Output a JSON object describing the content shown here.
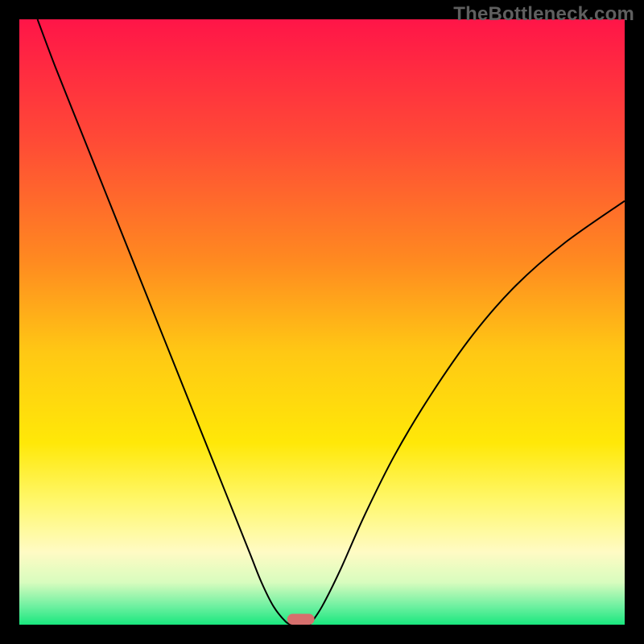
{
  "watermark": "TheBottleneck.com",
  "chart_data": {
    "type": "line",
    "title": "",
    "xlabel": "",
    "ylabel": "",
    "xlim": [
      0,
      100
    ],
    "ylim": [
      0,
      100
    ],
    "background_gradient": {
      "stops": [
        {
          "offset": 0.0,
          "color": "#ff1548"
        },
        {
          "offset": 0.2,
          "color": "#ff4a36"
        },
        {
          "offset": 0.4,
          "color": "#ff8a20"
        },
        {
          "offset": 0.55,
          "color": "#ffc814"
        },
        {
          "offset": 0.7,
          "color": "#ffe808"
        },
        {
          "offset": 0.8,
          "color": "#fff870"
        },
        {
          "offset": 0.88,
          "color": "#fffbc4"
        },
        {
          "offset": 0.93,
          "color": "#d8fcbe"
        },
        {
          "offset": 0.97,
          "color": "#6df0a0"
        },
        {
          "offset": 1.0,
          "color": "#19e77e"
        }
      ]
    },
    "series": [
      {
        "name": "left-branch",
        "x": [
          3.0,
          6.0,
          10.0,
          14.0,
          18.0,
          22.0,
          26.0,
          30.0,
          34.0,
          38.0,
          40.0,
          42.0,
          44.0,
          45.0
        ],
        "y": [
          100.0,
          92.0,
          82.0,
          72.0,
          62.0,
          52.0,
          42.0,
          32.0,
          22.0,
          12.0,
          7.0,
          3.0,
          0.5,
          0.0
        ]
      },
      {
        "name": "right-branch",
        "x": [
          48.0,
          50.0,
          53.0,
          57.0,
          62.0,
          68.0,
          75.0,
          82.0,
          90.0,
          100.0
        ],
        "y": [
          0.0,
          3.0,
          9.0,
          18.0,
          28.0,
          38.0,
          48.0,
          56.0,
          63.0,
          70.0
        ]
      }
    ],
    "marker": {
      "name": "interval-marker",
      "x_center": 46.5,
      "y": 0,
      "width": 4.5,
      "color": "#d66f6d"
    }
  }
}
